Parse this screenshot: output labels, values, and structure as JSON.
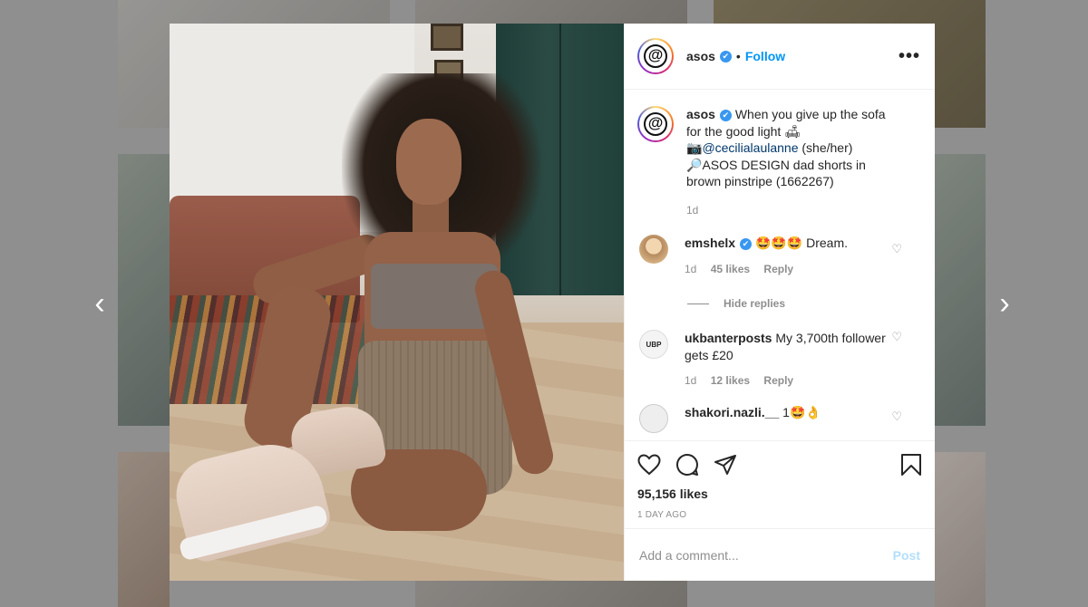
{
  "post": {
    "username": "asos",
    "verified_mark": "✔",
    "separator": "•",
    "follow_label": "Follow",
    "more_label": "•••",
    "logo_glyph": "@",
    "caption": {
      "line1": "When you give up the sofa for the good light 🛋",
      "credit_icon": "📷",
      "mention": "@cecilialaulanne",
      "pronouns": "(she/her)",
      "product_icon": "🔎",
      "product": "ASOS DESIGN dad shorts in brown pinstripe (1662267)",
      "time": "1d"
    },
    "comments": [
      {
        "username": "emshelx",
        "text": "🤩🤩🤩 Dream.",
        "time": "1d",
        "likes": "45 likes",
        "reply_label": "Reply",
        "avatar_color": "#c9a27a"
      },
      {
        "username": "ukbanterposts",
        "text": "My 3,700th follower gets £20",
        "time": "1d",
        "likes": "12 likes",
        "reply_label": "Reply",
        "avatar_color": "#f2f2f2"
      },
      {
        "username": "shakori.nazli.__",
        "text": "1🤩👌",
        "avatar_color": "#dcdcdc"
      }
    ],
    "hide_replies_label": "Hide replies",
    "likes_count": "95,156 likes",
    "posted_ago": "1 DAY AGO",
    "comment_placeholder": "Add a comment...",
    "post_label": "Post"
  },
  "nav": {
    "prev": "‹",
    "next": "›"
  },
  "colors": {
    "accent": "#0095f6",
    "verified": "#3897f0",
    "post_disabled": "#b2dffc"
  },
  "icons": [
    "heart-icon",
    "comment-icon",
    "share-icon",
    "bookmark-icon",
    "more-icon",
    "small-heart-icon"
  ]
}
